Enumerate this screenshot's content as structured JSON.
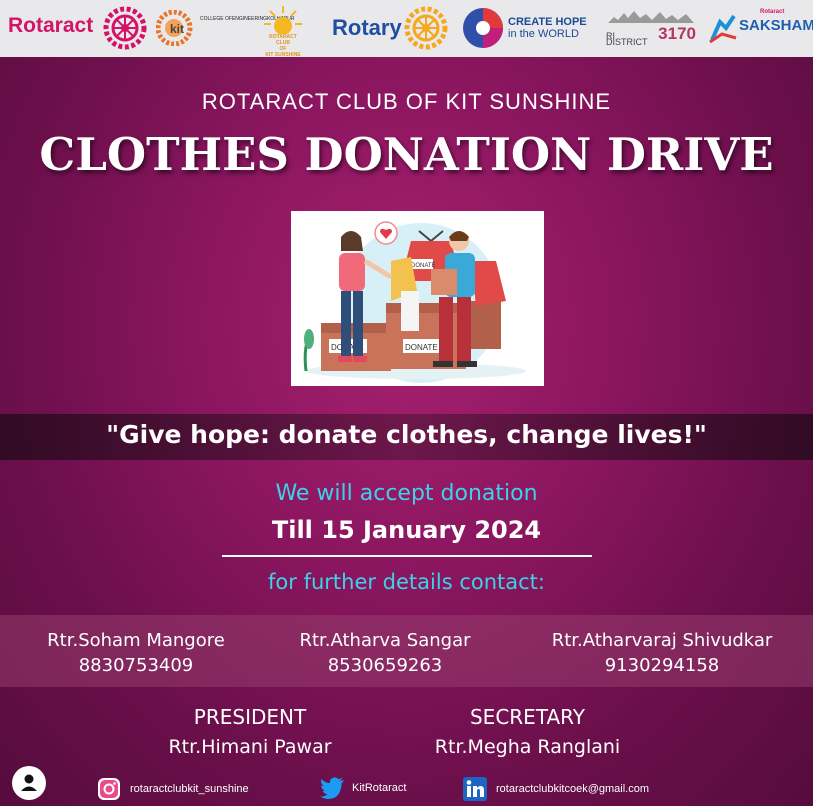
{
  "logos": {
    "rotaract": "Rotaract",
    "kit_lines": [
      "COLLEGE OF",
      "ENGINEERING",
      "KOLHAPUR"
    ],
    "sunshine_lines": [
      "ROTARACT CLUB",
      "OF",
      "KIT SUNSHINE"
    ],
    "rotary": "Rotary",
    "hope_line1": "CREATE HOPE",
    "hope_line2": "in the WORLD",
    "district_label": "RI DISTRICT",
    "district_number": "3170",
    "saksham_brand": "Rotaract",
    "saksham": "SAKSHAM"
  },
  "header": {
    "club": "ROTARACT CLUB OF KIT SUNSHINE",
    "title": "CLOTHES DONATION DRIVE"
  },
  "illustration": {
    "box1_label": "DONATE",
    "box2_label": "DONATE",
    "shirt_label": "DONATE"
  },
  "quote": "\"Give hope: donate clothes, change lives!\"",
  "accept_text": "We will accept donation",
  "till_text": "Till 15 January 2024",
  "further_text": "for further details contact:",
  "contacts": [
    {
      "name": "Rtr.Soham Mangore",
      "phone": "8830753409"
    },
    {
      "name": "Rtr.Atharva Sangar",
      "phone": "8530659263"
    },
    {
      "name": "Rtr.Atharvaraj Shivudkar",
      "phone": "9130294158"
    }
  ],
  "roles": [
    {
      "title": "PRESIDENT",
      "name": "Rtr.Himani Pawar"
    },
    {
      "title": "SECRETARY",
      "name": "Rtr.Megha Ranglani"
    }
  ],
  "footer": {
    "instagram": "rotaractclubkit_sunshine",
    "twitter": "KitRotaract",
    "email": "rotaractclubkitcoek@gmail.com"
  },
  "colors": {
    "background": "#8c1660",
    "accent_cyan": "#3fd1e8",
    "rotaract_pink": "#d41367",
    "rotary_blue": "#1f4f9e",
    "rotary_gold": "#f5a81c"
  }
}
